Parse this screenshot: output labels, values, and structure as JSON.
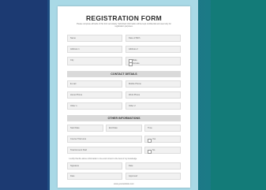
{
  "form": {
    "title": "REGISTRATION FORM",
    "intro": "Please complete all fields of this form accurately. Submitted information will be kept confidential and used only for registration purposes.",
    "personal": {
      "name_label": "Name",
      "dob_label": "Date of Birth",
      "address1_label": "Address 1",
      "address2_label": "Address 2",
      "city_label": "City",
      "gender_male": "Male",
      "gender_female": "Female"
    },
    "contact": {
      "heading": "CONTACT DETAILS",
      "email_label": "E-mail",
      "phone_label": "Mobile Phone",
      "home_phone_label": "Home Phone",
      "work_phone_label": "Work Phone",
      "other1_label": "Other 1",
      "other2_label": "Other 2"
    },
    "other": {
      "heading": "OTHER INFORMATIONS",
      "start_date_label": "Start Date",
      "end_date_label": "End Date",
      "time_label": "Time",
      "course_label": "Course Title Here",
      "total_label": "Total Amount Paid",
      "yes_label": "Yes",
      "no_label": "No"
    },
    "consent": {
      "note": "I certify that the above information is true and correct to the best of my knowledge.",
      "signature_label": "Signature",
      "date_label": "Date",
      "date2_label": "Date",
      "approved_label": "Approved"
    },
    "footer": "www.yourwebsite.com"
  }
}
